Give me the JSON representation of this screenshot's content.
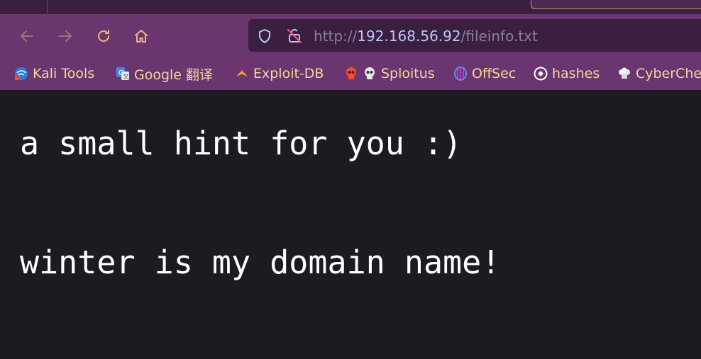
{
  "browser": {
    "url": {
      "scheme": "http://",
      "host": "192.168.56.92",
      "path": "/fileinfo.txt"
    },
    "bookmarks": [
      {
        "label": "Kali Tools",
        "icon": "kali-dragon-icon"
      },
      {
        "label": "Google 翻译",
        "icon": "google-translate-icon"
      },
      {
        "label": "Exploit-DB",
        "icon": "exploit-db-icon"
      },
      {
        "label": "Sploitus",
        "icon": "skull-icon"
      },
      {
        "label": "OffSec",
        "icon": "offsec-icon"
      },
      {
        "label": "hashes",
        "icon": "hashes-icon"
      },
      {
        "label": "CyberChe",
        "icon": "chef-hat-icon"
      }
    ],
    "colors": {
      "toolbar": "#6b3570",
      "urlbar": "#3a1f40",
      "bookmark_text": "#f3d79b",
      "nav_icon": "#f0b87a",
      "content_bg": "#1c1b22"
    }
  },
  "page": {
    "line1": "a small hint for you :)",
    "line2": "winter is my domain name!"
  }
}
